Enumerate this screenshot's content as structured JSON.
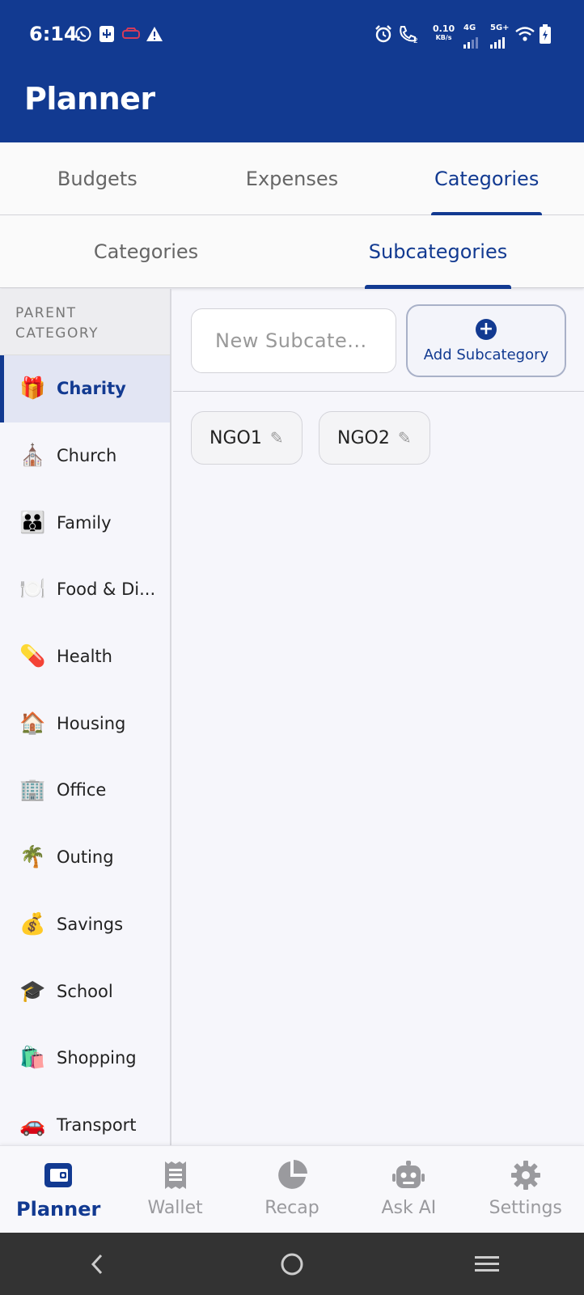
{
  "status_bar": {
    "time": "6:14",
    "net_speed_value": "0.10",
    "net_speed_unit": "KB/s",
    "network_4g": "4G",
    "network_5g": "5G+",
    "sim_slot": "2"
  },
  "app": {
    "title": "Planner"
  },
  "top_tabs": [
    {
      "label": "Budgets"
    },
    {
      "label": "Expenses"
    },
    {
      "label": "Categories"
    }
  ],
  "sub_tabs": [
    {
      "label": "Categories"
    },
    {
      "label": "Subcategories"
    }
  ],
  "sidebar": {
    "header_line1": "PARENT",
    "header_line2": "CATEGORY",
    "items": [
      {
        "emoji": "🎁",
        "label": "Charity",
        "selected": true
      },
      {
        "emoji": "⛪",
        "label": "Church"
      },
      {
        "emoji": "👪",
        "label": "Family"
      },
      {
        "emoji": "🍽️",
        "label": "Food & Di..."
      },
      {
        "emoji": "💊",
        "label": "Health"
      },
      {
        "emoji": "🏠",
        "label": "Housing"
      },
      {
        "emoji": "🏢",
        "label": "Office"
      },
      {
        "emoji": "🌴",
        "label": "Outing"
      },
      {
        "emoji": "💰",
        "label": "Savings"
      },
      {
        "emoji": "🎓",
        "label": "School"
      },
      {
        "emoji": "🛍️",
        "label": "Shopping"
      },
      {
        "emoji": "🚗",
        "label": "Transport"
      }
    ]
  },
  "subcategory_form": {
    "placeholder": "New Subcate...",
    "add_label": "Add Subcategory",
    "add_icon": "plus-circle-icon"
  },
  "subcategories": [
    {
      "label": "NGO1"
    },
    {
      "label": "NGO2"
    }
  ],
  "bottom_nav": [
    {
      "label": "Planner",
      "icon": "wallet-icon",
      "active": true
    },
    {
      "label": "Wallet",
      "icon": "receipt-icon"
    },
    {
      "label": "Recap",
      "icon": "pie-chart-icon"
    },
    {
      "label": "Ask AI",
      "icon": "robot-icon"
    },
    {
      "label": "Settings",
      "icon": "gear-icon"
    }
  ],
  "colors": {
    "primary": "#123a91",
    "background": "#f6f6fb",
    "selected_row": "#e2e5f3",
    "inactive": "#9a9a9e"
  }
}
